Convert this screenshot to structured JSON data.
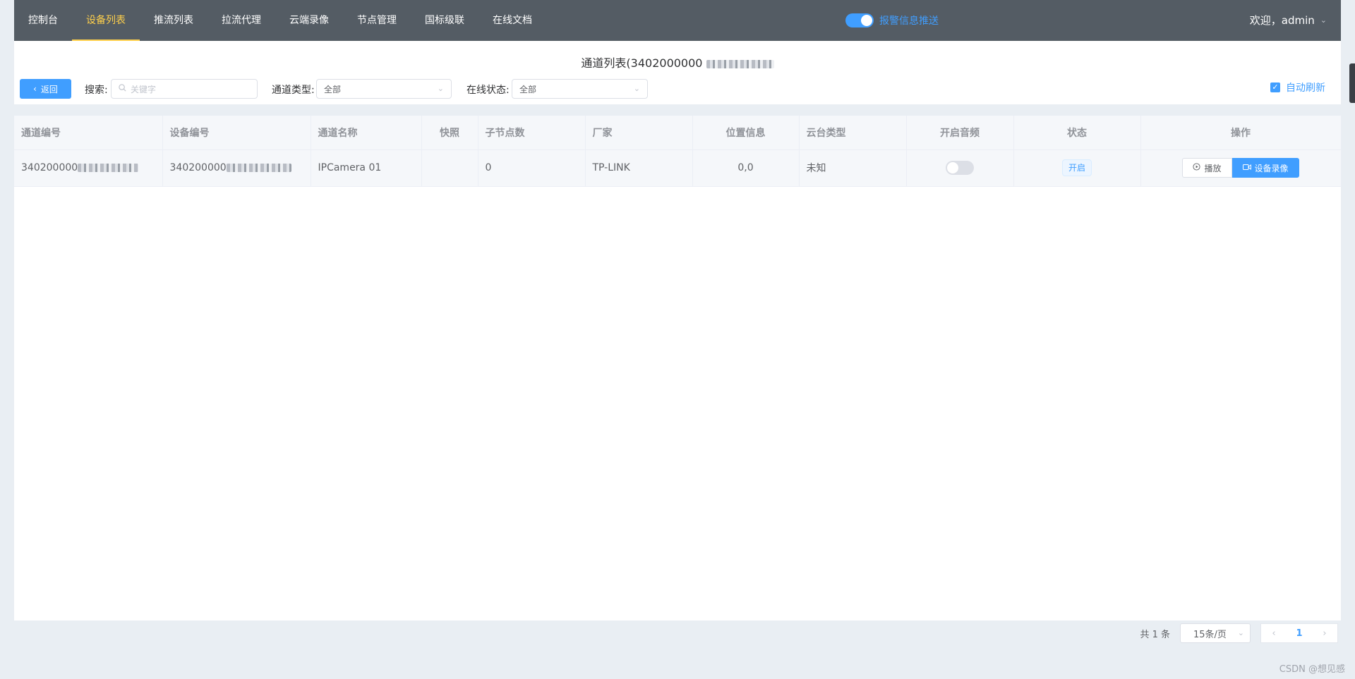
{
  "nav": {
    "items": [
      "控制台",
      "设备列表",
      "推流列表",
      "拉流代理",
      "云端录像",
      "节点管理",
      "国标级联",
      "在线文档"
    ],
    "active_index": 1,
    "alarm_label": "报警信息推送",
    "welcome": "欢迎，admin"
  },
  "page": {
    "title": "通道列表(3402000000",
    "back_label": "返回",
    "search_label": "搜索:",
    "search_placeholder": "关键字",
    "channel_type_label": "通道类型:",
    "channel_type_value": "全部",
    "online_status_label": "在线状态:",
    "online_status_value": "全部",
    "auto_refresh_label": "自动刷新"
  },
  "table": {
    "headers": [
      "通道编号",
      "设备编号",
      "通道名称",
      "快照",
      "子节点数",
      "厂家",
      "位置信息",
      "云台类型",
      "开启音频",
      "状态",
      "操作"
    ],
    "rows": [
      {
        "channel_id": "340200000",
        "device_id": "340200000",
        "channel_name": "IPCamera 01",
        "snapshot": "",
        "child_count": "0",
        "manufacturer": "TP-LINK",
        "location": "0,0",
        "ptz_type": "未知",
        "status": "开启",
        "play_label": "播放",
        "record_label": "设备录像"
      }
    ]
  },
  "pagination": {
    "total": "共 1 条",
    "page_size": "15条/页",
    "current_page": "1"
  },
  "watermark": "CSDN @想见感",
  "colors": {
    "nav_bg": "#545c64",
    "nav_active": "#ffd04b",
    "primary": "#409eff"
  }
}
